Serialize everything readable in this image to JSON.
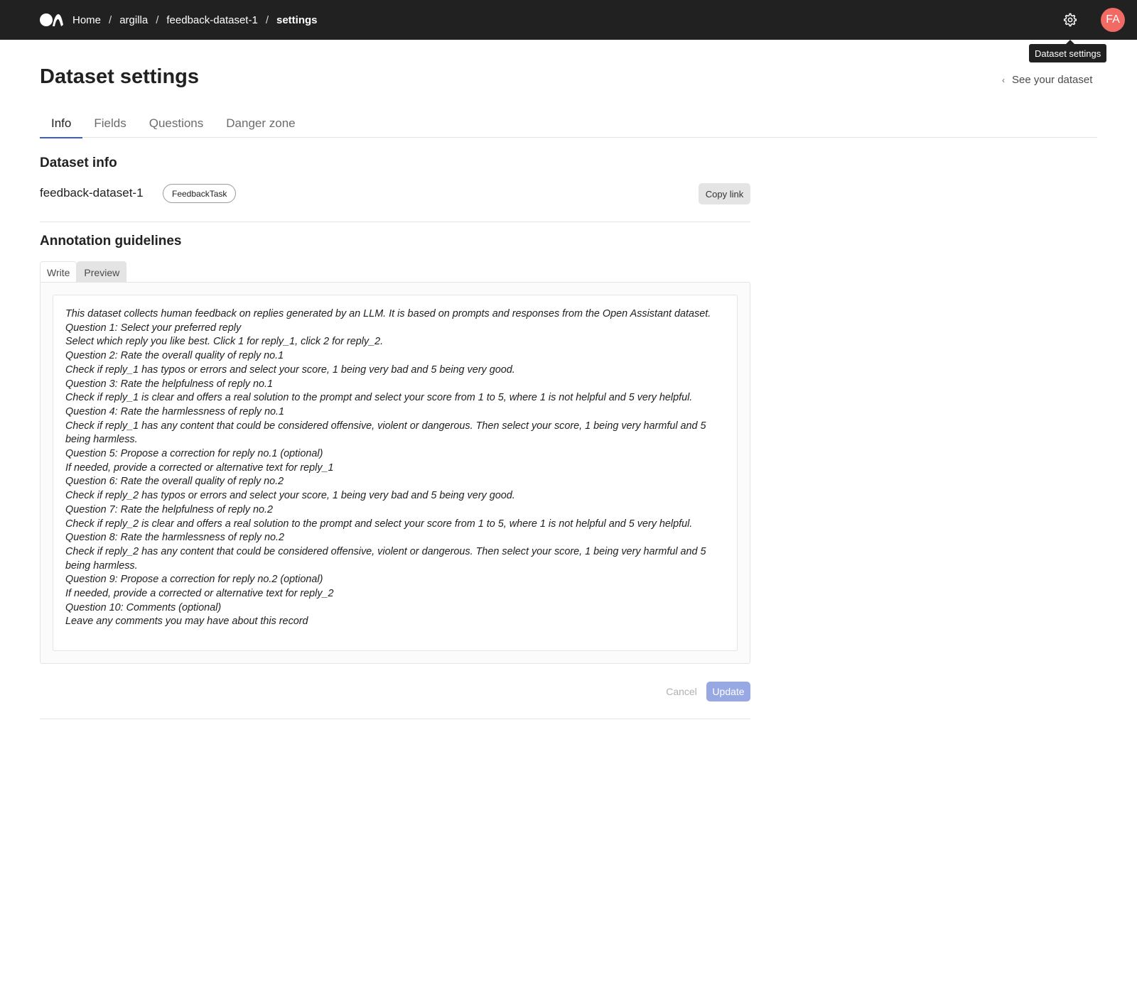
{
  "topbar": {
    "breadcrumb": [
      "Home",
      "argilla",
      "feedback-dataset-1",
      "settings"
    ],
    "separator": "/",
    "settings_icon": "gear-icon",
    "avatar_initials": "FA",
    "tooltip": "Dataset settings",
    "colors": {
      "background": "#212121",
      "avatar": "#f16a64"
    }
  },
  "header": {
    "title": "Dataset settings",
    "back_link": "See your dataset"
  },
  "tabs": [
    {
      "label": "Info",
      "active": true
    },
    {
      "label": "Fields",
      "active": false
    },
    {
      "label": "Questions",
      "active": false
    },
    {
      "label": "Danger zone",
      "active": false
    }
  ],
  "dataset_info": {
    "title": "Dataset info",
    "name": "feedback-dataset-1",
    "task": "FeedbackTask",
    "copy_link_label": "Copy link"
  },
  "guidelines": {
    "title": "Annotation guidelines",
    "tabs": [
      "Write",
      "Preview"
    ],
    "active_tab": "Write",
    "lines": [
      "This dataset collects human feedback on replies generated by an LLM. It is based on prompts and responses from the Open Assistant dataset.",
      "Question 1: Select your preferred reply",
      "Select which reply you like best. Click 1 for reply_1, click 2 for reply_2.",
      "Question 2: Rate the overall quality of reply no.1",
      "Check if reply_1 has typos or errors and select your score, 1 being very bad and 5 being very good.",
      "Question 3: Rate the helpfulness of reply no.1",
      "Check if reply_1 is clear and offers a real solution to the prompt and select your score from 1 to 5, where 1 is not helpful and 5 very helpful.",
      "Question 4: Rate the harmlessness of reply no.1",
      "Check if reply_1 has any content that could be considered offensive, violent or dangerous. Then select your score, 1 being very harmful and 5 being harmless.",
      "Question 5: Propose a correction for reply no.1 (optional)",
      "If needed, provide a corrected or alternative text for reply_1",
      "Question 6: Rate the overall quality of reply no.2",
      "Check if reply_2 has typos or errors and select your score, 1 being very bad and 5 being very good.",
      "Question 7: Rate the helpfulness of reply no.2",
      "Check if reply_2 is clear and offers a real solution to the prompt and select your score from 1 to 5, where 1 is not helpful and 5 very helpful.",
      "Question 8: Rate the harmlessness of reply no.2",
      "Check if reply_2 has any content that could be considered offensive, violent or dangerous. Then select your score, 1 being very harmful and 5 being harmless.",
      "Question 9: Propose a correction for reply no.2 (optional)",
      "If needed, provide a corrected or alternative text for reply_2",
      "Question 10: Comments (optional)",
      "Leave any comments you may have about this record"
    ]
  },
  "actions": {
    "cancel_label": "Cancel",
    "update_label": "Update",
    "colors": {
      "update": "#98a8e3"
    }
  }
}
